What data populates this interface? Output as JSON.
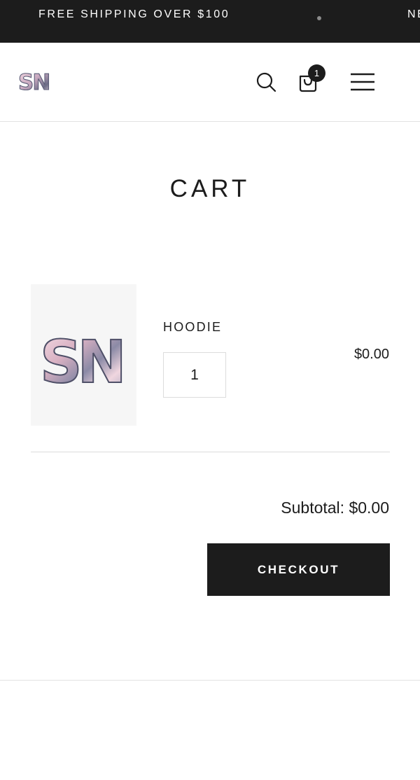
{
  "announcement": {
    "message": "FREE SHIPPING OVER $100",
    "next_message_fragment": "NE"
  },
  "header": {
    "logo_text": "SN",
    "cart_count": "1",
    "icons": [
      "search-icon",
      "shopping-bag-icon",
      "hamburger-menu-icon"
    ]
  },
  "cart": {
    "title": "CART",
    "items": [
      {
        "image_text": "SN",
        "name": "HOODIE",
        "quantity": "1",
        "price": "$0.00"
      }
    ],
    "subtotal": "Subtotal: $0.00",
    "checkout_label": "CHECKOUT"
  },
  "colors": {
    "dark": "#1c1c1c",
    "background": "#ffffff",
    "thumb_bg": "#f6f6f6",
    "divider": "#dcdcdc"
  }
}
